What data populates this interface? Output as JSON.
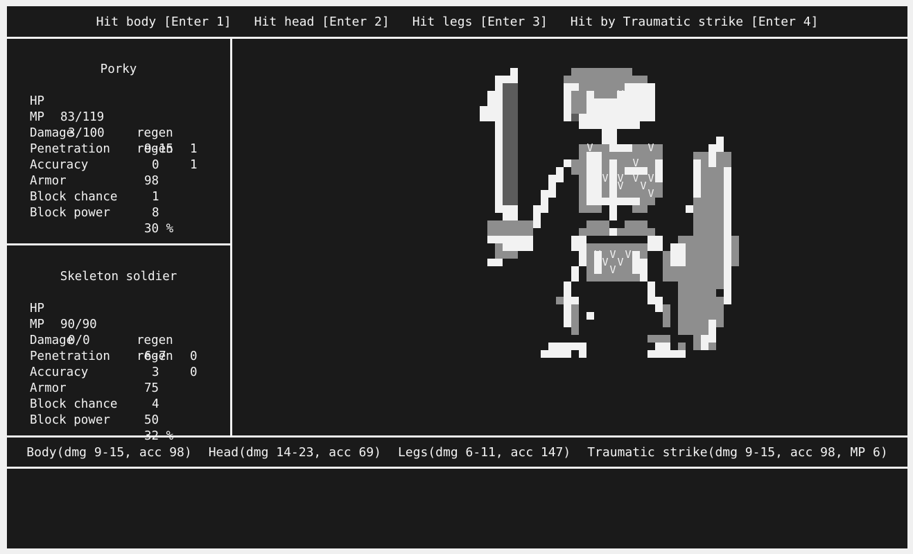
{
  "actions": [
    {
      "label": "Hit body [Enter 1]"
    },
    {
      "label": "Hit head [Enter 2]"
    },
    {
      "label": "Hit legs [Enter 3]"
    },
    {
      "label": "Hit by Traumatic strike [Enter 4]"
    }
  ],
  "player": {
    "name": "Porky",
    "hp": "83/119",
    "hp_regen": "1",
    "mp": "3/100",
    "mp_regen": "1",
    "damage": "9-15",
    "penetration": "0",
    "accuracy": "98",
    "armor": "1",
    "block_chance": "8",
    "block_power": "30 %"
  },
  "enemy": {
    "name": "Skeleton soldier",
    "hp": "90/90",
    "hp_regen": "0",
    "mp": "0/0",
    "mp_regen": "0",
    "damage": "6-7",
    "penetration": "3",
    "accuracy": "75",
    "armor": "4",
    "block_chance": "50",
    "block_power": "32 %"
  },
  "labels": {
    "hp": "HP",
    "mp": "MP",
    "regen": "regen",
    "damage": "Damage",
    "penetration": "Penetration",
    "accuracy": "Accuracy",
    "armor": "Armor",
    "block_chance": "Block chance",
    "block_power": "Block power"
  },
  "attacks": [
    {
      "label": "Body(dmg 9-15, acc 98)"
    },
    {
      "label": "Head(dmg 14-23, acc 69)"
    },
    {
      "label": "Legs(dmg 6-11, acc 147)"
    },
    {
      "label": "Traumatic strike(dmg 9-15, acc 98, MP 6)"
    }
  ],
  "sprite": {
    "name": "skeleton-soldier",
    "colors": {
      "light": "#f2f2f2",
      "mid": "#8e8e8e",
      "dark": "#5c5c5c"
    },
    "glyph": "V"
  }
}
